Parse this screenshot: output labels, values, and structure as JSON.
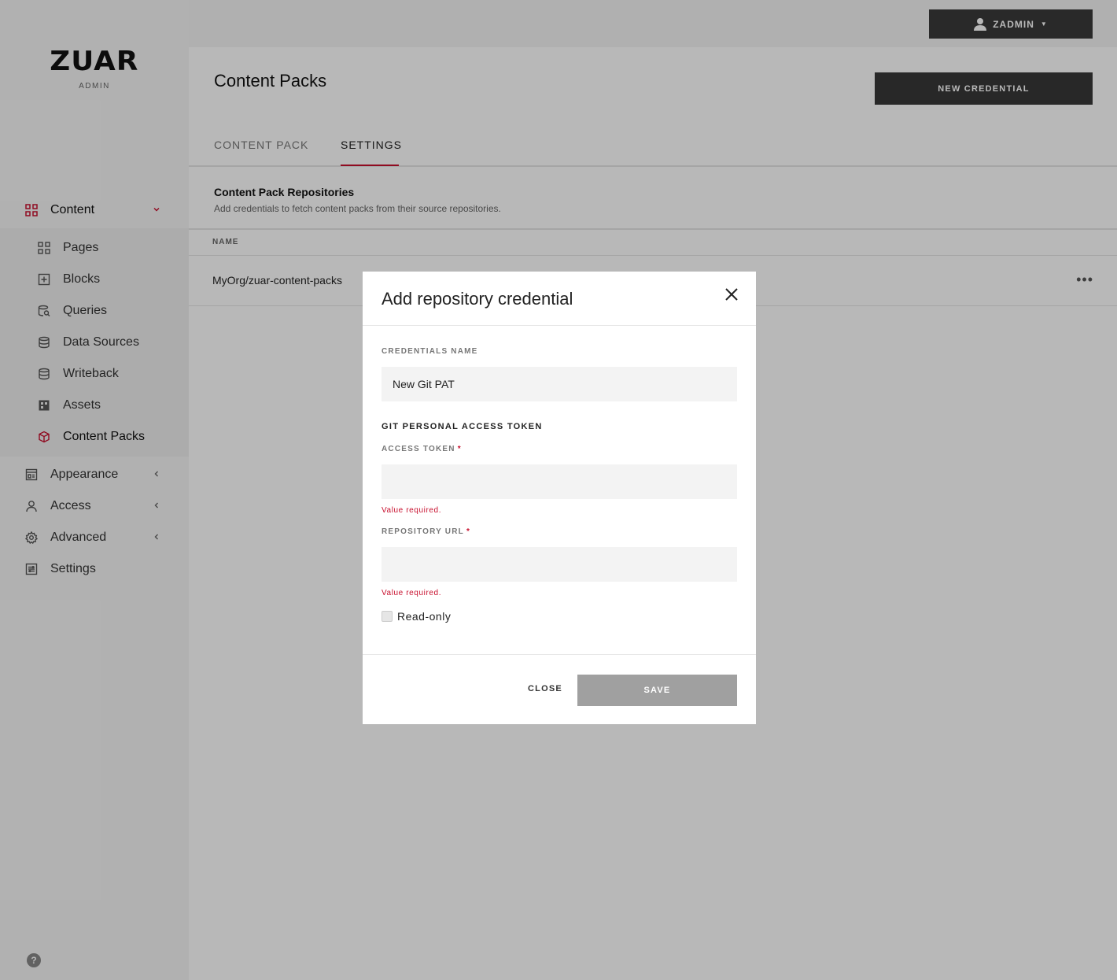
{
  "brand": {
    "logo": "ZUAR",
    "subtitle": "ADMIN"
  },
  "user": {
    "name": "ZADMIN"
  },
  "sidebar": {
    "sections": [
      {
        "label": "Content",
        "icon": "grid-icon",
        "expanded": true
      },
      {
        "label": "Appearance",
        "icon": "appearance-icon"
      },
      {
        "label": "Access",
        "icon": "person-icon"
      },
      {
        "label": "Advanced",
        "icon": "gear-icon"
      },
      {
        "label": "Settings",
        "icon": "settings-icon"
      }
    ],
    "content_items": [
      {
        "label": "Pages",
        "icon": "grid-icon"
      },
      {
        "label": "Blocks",
        "icon": "plus-box-icon"
      },
      {
        "label": "Queries",
        "icon": "query-icon"
      },
      {
        "label": "Data Sources",
        "icon": "database-icon"
      },
      {
        "label": "Writeback",
        "icon": "database-icon"
      },
      {
        "label": "Assets",
        "icon": "assets-icon"
      },
      {
        "label": "Content Packs",
        "icon": "package-icon"
      }
    ],
    "help": "?"
  },
  "page": {
    "title": "Content Packs",
    "new_button": "NEW CREDENTIAL",
    "tabs": [
      {
        "label": "CONTENT PACK"
      },
      {
        "label": "SETTINGS"
      }
    ],
    "section_title": "Content Pack Repositories",
    "section_desc": "Add credentials to fetch content packs from their source repositories.",
    "table": {
      "header_name": "NAME",
      "rows": [
        {
          "name": "MyOrg/zuar-content-packs",
          "menu": "•••"
        }
      ]
    }
  },
  "modal": {
    "title": "Add repository credential",
    "credentials_name_label": "CREDENTIALS NAME",
    "credentials_name_value": "New Git PAT",
    "group_label": "GIT PERSONAL ACCESS TOKEN",
    "access_token_label": "ACCESS TOKEN",
    "access_token_value": "",
    "access_token_error": "Value required.",
    "repo_url_label": "REPOSITORY URL",
    "repo_url_value": "",
    "repo_url_error": "Value required.",
    "required_mark": "*",
    "readonly_label": "Read-only",
    "readonly_checked": false,
    "close_label": "CLOSE",
    "save_label": "SAVE"
  },
  "colors": {
    "accent": "#c8102e",
    "dark_button": "#383838",
    "disabled_button": "#a0a0a0"
  }
}
